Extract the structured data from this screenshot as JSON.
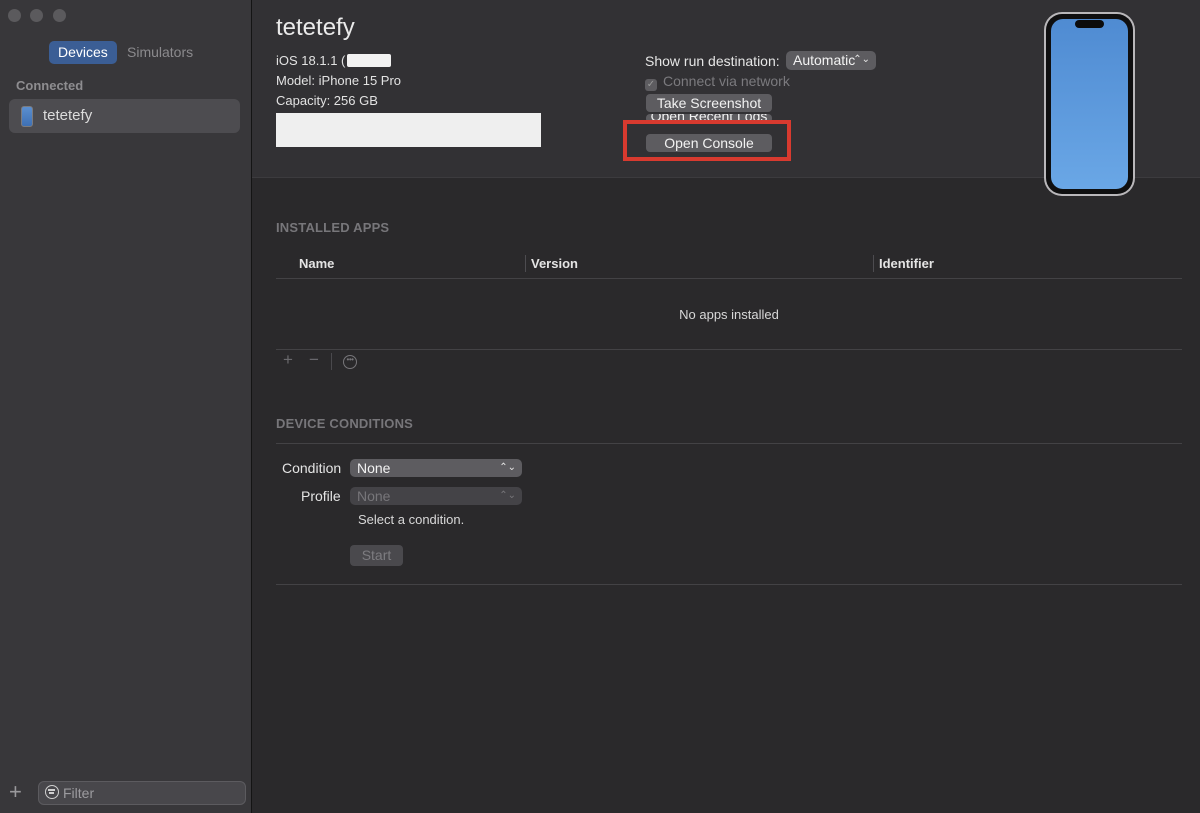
{
  "window": {
    "traffic_lights": [
      "close",
      "minimize",
      "zoom"
    ]
  },
  "sidebar": {
    "tabs": [
      {
        "label": "Devices",
        "active": true
      },
      {
        "label": "Simulators",
        "active": false
      }
    ],
    "section_label": "Connected",
    "devices": [
      {
        "name": "tetetefy",
        "icon": "iphone-icon",
        "selected": true
      }
    ],
    "add_icon": "plus-icon",
    "filter": {
      "placeholder": "Filter",
      "value": ""
    }
  },
  "device": {
    "name": "tetetefy",
    "ios": "iOS 18.1.1 (",
    "model": "Model: iPhone 15 Pro",
    "capacity": "Capacity: 256 GB"
  },
  "run_destination": {
    "label": "Show run destination:",
    "value": "Automatic",
    "connect_via_network": {
      "label": "Connect via network",
      "checked": true,
      "enabled": false
    }
  },
  "actions": {
    "take_screenshot": "Take Screenshot",
    "open_recent_logs": "Open Recent Logs",
    "open_console": "Open Console"
  },
  "installed_apps": {
    "title": "INSTALLED APPS",
    "columns": [
      "Name",
      "Version",
      "Identifier"
    ],
    "empty_message": "No apps installed",
    "toolbar": [
      "plus-icon",
      "minus-icon",
      "ellipsis-circle-icon"
    ]
  },
  "device_conditions": {
    "title": "DEVICE CONDITIONS",
    "condition_label": "Condition",
    "condition_value": "None",
    "profile_label": "Profile",
    "profile_value": "None",
    "hint": "Select a condition.",
    "start_label": "Start"
  },
  "colors": {
    "accent": "#3b5e95",
    "highlight": "#d83a2f",
    "sidebar_bg": "#38373a",
    "main_bg": "#2a292b"
  }
}
